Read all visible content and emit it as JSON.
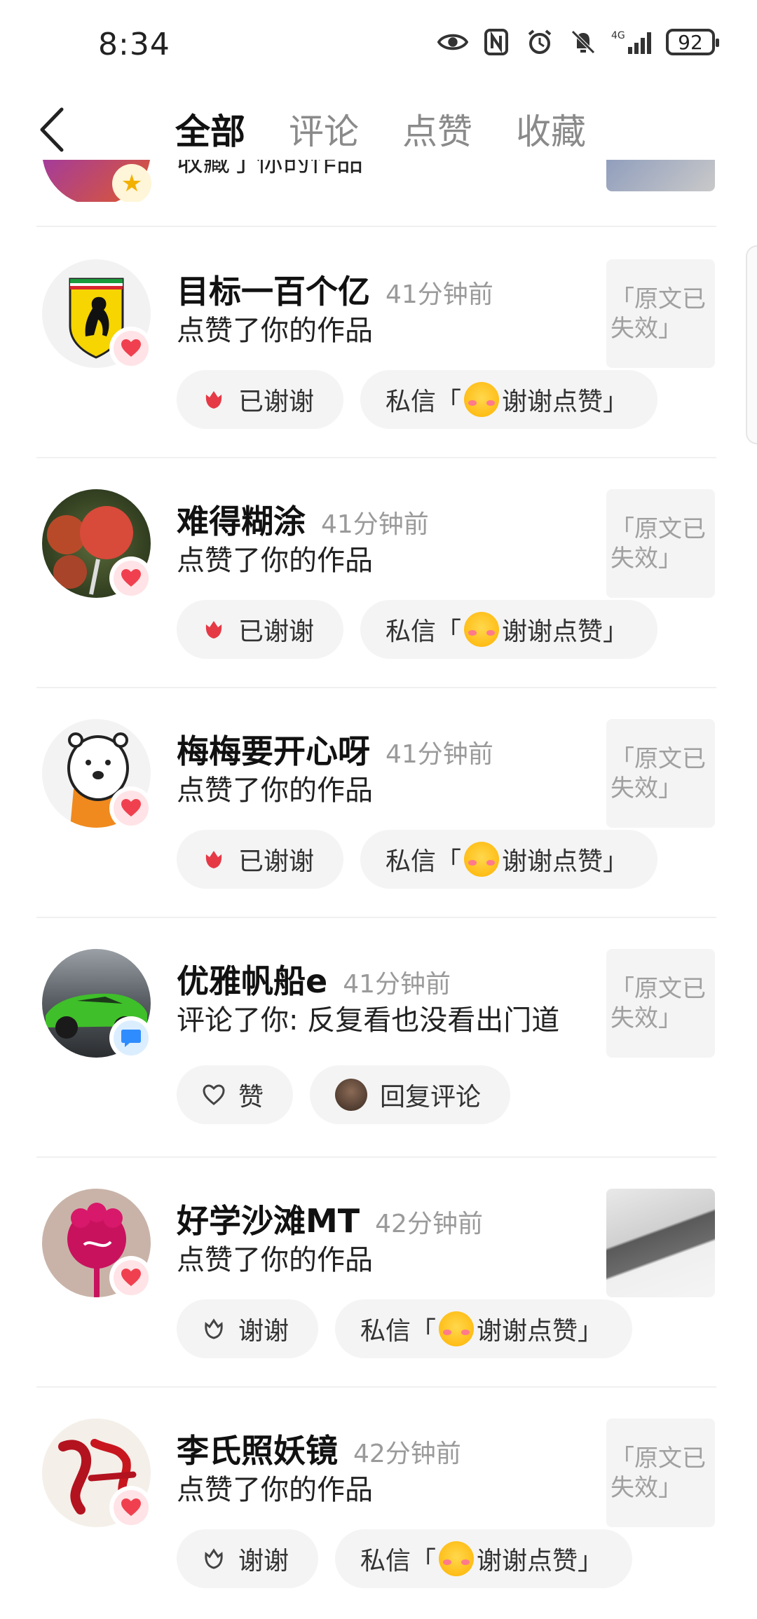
{
  "status_bar": {
    "time": "8:34",
    "network": "4G",
    "battery": "92",
    "icons": [
      "eye-icon",
      "nfc-icon",
      "alarm-icon",
      "mute-icon",
      "signal-icon",
      "battery-icon"
    ]
  },
  "nav": {
    "tabs": [
      {
        "label": "全部",
        "active": true
      },
      {
        "label": "评论",
        "active": false
      },
      {
        "label": "点赞",
        "active": false
      },
      {
        "label": "收藏",
        "active": false
      }
    ]
  },
  "partial_item": {
    "action": "收藏了你的作品"
  },
  "items": [
    {
      "name": "目标一百个亿",
      "time": "41分钟前",
      "action": "点赞了你的作品",
      "thumb": "「原文已失效」",
      "badge": "heart-icon",
      "buttons": {
        "thank": "已谢谢",
        "dm": "私信「",
        "dm_tail": "谢谢点赞」"
      }
    },
    {
      "name": "难得糊涂",
      "time": "41分钟前",
      "action": "点赞了你的作品",
      "thumb": "「原文已失效」",
      "badge": "heart-icon",
      "buttons": {
        "thank": "已谢谢",
        "dm": "私信「",
        "dm_tail": "谢谢点赞」"
      }
    },
    {
      "name": "梅梅要开心呀",
      "time": "41分钟前",
      "action": "点赞了你的作品",
      "thumb": "「原文已失效」",
      "badge": "heart-icon",
      "buttons": {
        "thank": "已谢谢",
        "dm": "私信「",
        "dm_tail": "谢谢点赞」"
      }
    },
    {
      "name": "优雅帆船e",
      "time": "41分钟前",
      "action": "评论了你: 反复看也没看出门道",
      "thumb": "「原文已失效」",
      "badge": "comment-icon",
      "buttons": {
        "like": "赞",
        "reply": "回复评论"
      }
    },
    {
      "name": "好学沙滩MT",
      "time": "42分钟前",
      "action": "点赞了你的作品",
      "badge": "heart-icon",
      "buttons": {
        "thank": "谢谢",
        "dm": "私信「",
        "dm_tail": "谢谢点赞」"
      }
    },
    {
      "name": "李氏照妖镜",
      "time": "42分钟前",
      "action": "点赞了你的作品",
      "thumb": "「原文已失效」",
      "badge": "heart-icon",
      "buttons": {
        "thank": "谢谢",
        "dm": "私信「",
        "dm_tail": "谢谢点赞」"
      }
    }
  ],
  "colors": {
    "accent_red": "#f0404f",
    "comment_blue": "#2f8cff",
    "muted_text": "#9a9a9a",
    "button_bg": "#f4f4f4"
  }
}
